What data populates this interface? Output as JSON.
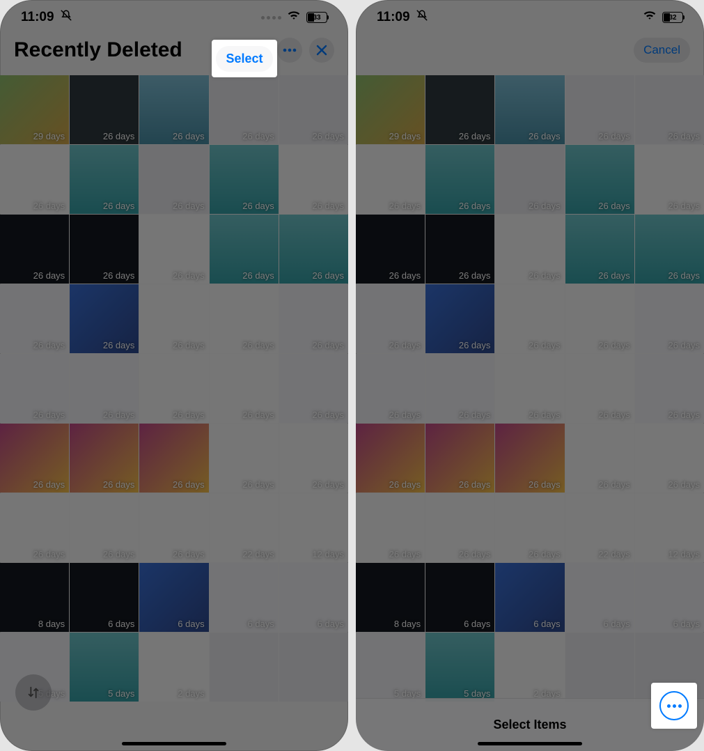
{
  "left": {
    "status": {
      "time": "11:09",
      "battery": "33"
    },
    "header": {
      "title": "Recently Deleted",
      "select": "Select"
    },
    "grid_days": [
      "29 days",
      "26 days",
      "26 days",
      "26 days",
      "26 days",
      "26 days",
      "26 days",
      "26 days",
      "26 days",
      "26 days",
      "26 days",
      "26 days",
      "26 days",
      "26 days",
      "26 days",
      "26 days",
      "26 days",
      "26 days",
      "26 days",
      "26 days",
      "26 days",
      "26 days",
      "26 days",
      "26 days",
      "26 days",
      "26 days",
      "26 days",
      "26 days",
      "26 days",
      "26 days",
      "26 days",
      "26 days",
      "26 days",
      "22 days",
      "12 days",
      "8 days",
      "6 days",
      "6 days",
      "6 days",
      "6 days",
      "5 days",
      "5 days",
      "2 days",
      "",
      ""
    ]
  },
  "right": {
    "status": {
      "time": "11:09",
      "battery": "32"
    },
    "header": {
      "cancel": "Cancel"
    },
    "bottom": {
      "title": "Select Items"
    },
    "grid_days": [
      "29 days",
      "26 days",
      "26 days",
      "26 days",
      "26 days",
      "26 days",
      "26 days",
      "26 days",
      "26 days",
      "26 days",
      "26 days",
      "26 days",
      "26 days",
      "26 days",
      "26 days",
      "26 days",
      "26 days",
      "26 days",
      "26 days",
      "26 days",
      "26 days",
      "26 days",
      "26 days",
      "26 days",
      "26 days",
      "26 days",
      "26 days",
      "26 days",
      "26 days",
      "26 days",
      "26 days",
      "26 days",
      "26 days",
      "22 days",
      "12 days",
      "8 days",
      "6 days",
      "6 days",
      "6 days",
      "6 days",
      "5 days",
      "5 days",
      "2 days",
      "",
      ""
    ]
  },
  "thumb_classes": [
    "c1",
    "c2",
    "c3",
    "c4",
    "c4",
    "c6",
    "c5",
    "c4",
    "c5",
    "c6",
    "c8",
    "c8",
    "c6",
    "c5",
    "c5",
    "c10",
    "c9",
    "c6",
    "c6",
    "c10",
    "c10",
    "c10",
    "c6",
    "c6",
    "c10",
    "c7",
    "c7",
    "c7",
    "c6",
    "c6",
    "c6",
    "c6",
    "c6",
    "c6",
    "c6",
    "c8",
    "c8",
    "c9",
    "c10",
    "c10",
    "c10",
    "c5",
    "c6",
    "c4",
    "c4"
  ]
}
